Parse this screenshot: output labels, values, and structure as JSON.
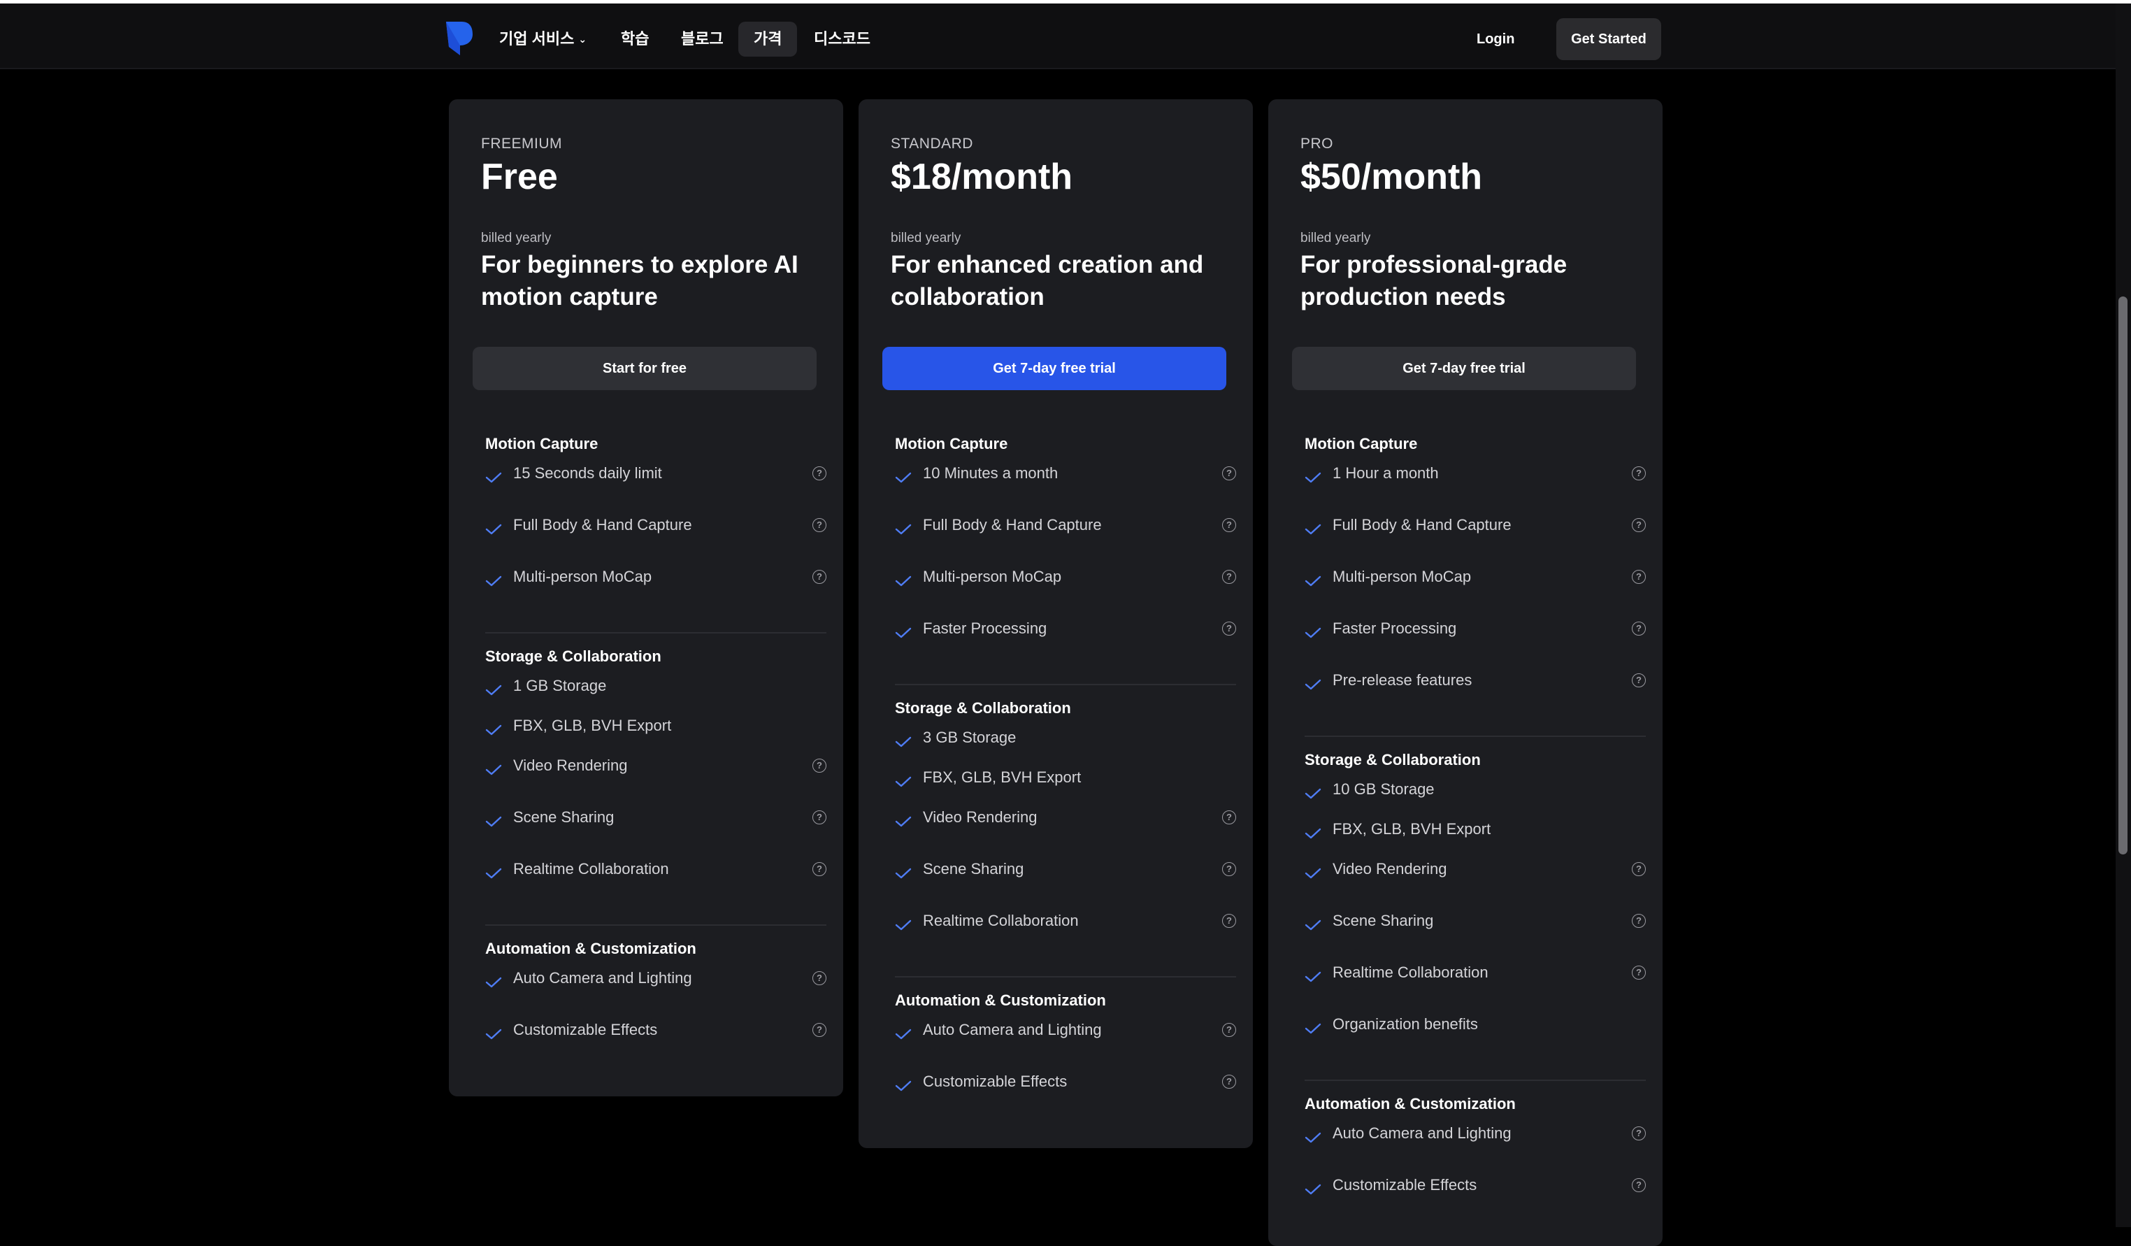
{
  "nav": {
    "items": [
      "기업 서비스",
      "학습",
      "블로그",
      "가격",
      "디스코드"
    ],
    "dropdown_indicator": "⌄",
    "login": "Login",
    "get_started": "Get Started"
  },
  "colors": {
    "accent": "#2855e8",
    "card_bg": "#1c1d21",
    "check": "#4f7df5"
  },
  "plans": [
    {
      "tier": "FREEMIUM",
      "price": "Free",
      "billed": "billed yearly",
      "description": "For beginners to explore AI motion capture",
      "cta": "Start for free",
      "sections": [
        {
          "title": "Motion Capture",
          "features": [
            {
              "label": "15 Seconds daily limit",
              "help": true
            },
            {
              "label": "Full Body & Hand Capture",
              "help": true
            },
            {
              "label": "Multi-person MoCap",
              "help": true
            }
          ]
        },
        {
          "title": "Storage & Collaboration",
          "features": [
            {
              "label": "1 GB Storage",
              "help": false
            },
            {
              "label": "FBX, GLB, BVH Export",
              "help": false
            },
            {
              "label": "Video Rendering",
              "help": true
            },
            {
              "label": "Scene Sharing",
              "help": true
            },
            {
              "label": "Realtime Collaboration",
              "help": true
            }
          ]
        },
        {
          "title": "Automation & Customization",
          "features": [
            {
              "label": "Auto Camera and Lighting",
              "help": true
            },
            {
              "label": "Customizable Effects",
              "help": true
            }
          ]
        }
      ]
    },
    {
      "tier": "STANDARD",
      "price": "$18/month",
      "billed": "billed yearly",
      "description": "For enhanced creation and collaboration",
      "cta": "Get 7-day free trial",
      "sections": [
        {
          "title": "Motion Capture",
          "features": [
            {
              "label": "10 Minutes a month",
              "help": true
            },
            {
              "label": "Full Body & Hand Capture",
              "help": true
            },
            {
              "label": "Multi-person MoCap",
              "help": true
            },
            {
              "label": "Faster Processing",
              "help": true
            }
          ]
        },
        {
          "title": "Storage & Collaboration",
          "features": [
            {
              "label": "3 GB Storage",
              "help": false
            },
            {
              "label": "FBX, GLB, BVH Export",
              "help": false
            },
            {
              "label": "Video Rendering",
              "help": true
            },
            {
              "label": "Scene Sharing",
              "help": true
            },
            {
              "label": "Realtime Collaboration",
              "help": true
            }
          ]
        },
        {
          "title": "Automation & Customization",
          "features": [
            {
              "label": "Auto Camera and Lighting",
              "help": true
            },
            {
              "label": "Customizable Effects",
              "help": true
            }
          ]
        }
      ]
    },
    {
      "tier": "PRO",
      "price": "$50/month",
      "billed": "billed yearly",
      "description": "For professional-grade production needs",
      "cta": "Get 7-day free trial",
      "sections": [
        {
          "title": "Motion Capture",
          "features": [
            {
              "label": "1 Hour a month",
              "help": true
            },
            {
              "label": "Full Body & Hand Capture",
              "help": true
            },
            {
              "label": "Multi-person MoCap",
              "help": true
            },
            {
              "label": "Faster Processing",
              "help": true
            },
            {
              "label": "Pre-release features",
              "help": true
            }
          ]
        },
        {
          "title": "Storage & Collaboration",
          "features": [
            {
              "label": "10 GB Storage",
              "help": false
            },
            {
              "label": "FBX, GLB, BVH Export",
              "help": false
            },
            {
              "label": "Video Rendering",
              "help": true
            },
            {
              "label": "Scene Sharing",
              "help": true
            },
            {
              "label": "Realtime Collaboration",
              "help": true
            },
            {
              "label": "Organization benefits",
              "help": false
            }
          ]
        },
        {
          "title": "Automation & Customization",
          "features": [
            {
              "label": "Auto Camera and Lighting",
              "help": true
            },
            {
              "label": "Customizable Effects",
              "help": true
            }
          ]
        }
      ]
    }
  ]
}
